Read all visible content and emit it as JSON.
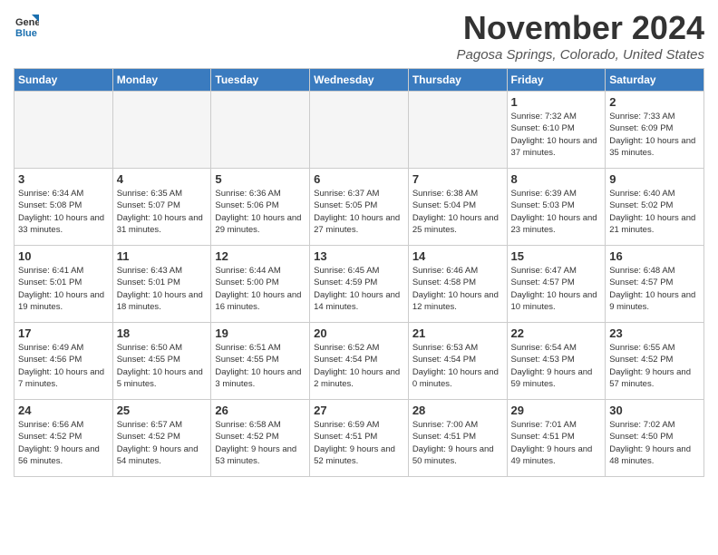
{
  "header": {
    "logo_line1": "General",
    "logo_line2": "Blue",
    "month": "November 2024",
    "location": "Pagosa Springs, Colorado, United States"
  },
  "weekdays": [
    "Sunday",
    "Monday",
    "Tuesday",
    "Wednesday",
    "Thursday",
    "Friday",
    "Saturday"
  ],
  "weeks": [
    [
      {
        "day": "",
        "info": ""
      },
      {
        "day": "",
        "info": ""
      },
      {
        "day": "",
        "info": ""
      },
      {
        "day": "",
        "info": ""
      },
      {
        "day": "",
        "info": ""
      },
      {
        "day": "1",
        "info": "Sunrise: 7:32 AM\nSunset: 6:10 PM\nDaylight: 10 hours and 37 minutes."
      },
      {
        "day": "2",
        "info": "Sunrise: 7:33 AM\nSunset: 6:09 PM\nDaylight: 10 hours and 35 minutes."
      }
    ],
    [
      {
        "day": "3",
        "info": "Sunrise: 6:34 AM\nSunset: 5:08 PM\nDaylight: 10 hours and 33 minutes."
      },
      {
        "day": "4",
        "info": "Sunrise: 6:35 AM\nSunset: 5:07 PM\nDaylight: 10 hours and 31 minutes."
      },
      {
        "day": "5",
        "info": "Sunrise: 6:36 AM\nSunset: 5:06 PM\nDaylight: 10 hours and 29 minutes."
      },
      {
        "day": "6",
        "info": "Sunrise: 6:37 AM\nSunset: 5:05 PM\nDaylight: 10 hours and 27 minutes."
      },
      {
        "day": "7",
        "info": "Sunrise: 6:38 AM\nSunset: 5:04 PM\nDaylight: 10 hours and 25 minutes."
      },
      {
        "day": "8",
        "info": "Sunrise: 6:39 AM\nSunset: 5:03 PM\nDaylight: 10 hours and 23 minutes."
      },
      {
        "day": "9",
        "info": "Sunrise: 6:40 AM\nSunset: 5:02 PM\nDaylight: 10 hours and 21 minutes."
      }
    ],
    [
      {
        "day": "10",
        "info": "Sunrise: 6:41 AM\nSunset: 5:01 PM\nDaylight: 10 hours and 19 minutes."
      },
      {
        "day": "11",
        "info": "Sunrise: 6:43 AM\nSunset: 5:01 PM\nDaylight: 10 hours and 18 minutes."
      },
      {
        "day": "12",
        "info": "Sunrise: 6:44 AM\nSunset: 5:00 PM\nDaylight: 10 hours and 16 minutes."
      },
      {
        "day": "13",
        "info": "Sunrise: 6:45 AM\nSunset: 4:59 PM\nDaylight: 10 hours and 14 minutes."
      },
      {
        "day": "14",
        "info": "Sunrise: 6:46 AM\nSunset: 4:58 PM\nDaylight: 10 hours and 12 minutes."
      },
      {
        "day": "15",
        "info": "Sunrise: 6:47 AM\nSunset: 4:57 PM\nDaylight: 10 hours and 10 minutes."
      },
      {
        "day": "16",
        "info": "Sunrise: 6:48 AM\nSunset: 4:57 PM\nDaylight: 10 hours and 9 minutes."
      }
    ],
    [
      {
        "day": "17",
        "info": "Sunrise: 6:49 AM\nSunset: 4:56 PM\nDaylight: 10 hours and 7 minutes."
      },
      {
        "day": "18",
        "info": "Sunrise: 6:50 AM\nSunset: 4:55 PM\nDaylight: 10 hours and 5 minutes."
      },
      {
        "day": "19",
        "info": "Sunrise: 6:51 AM\nSunset: 4:55 PM\nDaylight: 10 hours and 3 minutes."
      },
      {
        "day": "20",
        "info": "Sunrise: 6:52 AM\nSunset: 4:54 PM\nDaylight: 10 hours and 2 minutes."
      },
      {
        "day": "21",
        "info": "Sunrise: 6:53 AM\nSunset: 4:54 PM\nDaylight: 10 hours and 0 minutes."
      },
      {
        "day": "22",
        "info": "Sunrise: 6:54 AM\nSunset: 4:53 PM\nDaylight: 9 hours and 59 minutes."
      },
      {
        "day": "23",
        "info": "Sunrise: 6:55 AM\nSunset: 4:52 PM\nDaylight: 9 hours and 57 minutes."
      }
    ],
    [
      {
        "day": "24",
        "info": "Sunrise: 6:56 AM\nSunset: 4:52 PM\nDaylight: 9 hours and 56 minutes."
      },
      {
        "day": "25",
        "info": "Sunrise: 6:57 AM\nSunset: 4:52 PM\nDaylight: 9 hours and 54 minutes."
      },
      {
        "day": "26",
        "info": "Sunrise: 6:58 AM\nSunset: 4:52 PM\nDaylight: 9 hours and 53 minutes."
      },
      {
        "day": "27",
        "info": "Sunrise: 6:59 AM\nSunset: 4:51 PM\nDaylight: 9 hours and 52 minutes."
      },
      {
        "day": "28",
        "info": "Sunrise: 7:00 AM\nSunset: 4:51 PM\nDaylight: 9 hours and 50 minutes."
      },
      {
        "day": "29",
        "info": "Sunrise: 7:01 AM\nSunset: 4:51 PM\nDaylight: 9 hours and 49 minutes."
      },
      {
        "day": "30",
        "info": "Sunrise: 7:02 AM\nSunset: 4:50 PM\nDaylight: 9 hours and 48 minutes."
      }
    ]
  ]
}
